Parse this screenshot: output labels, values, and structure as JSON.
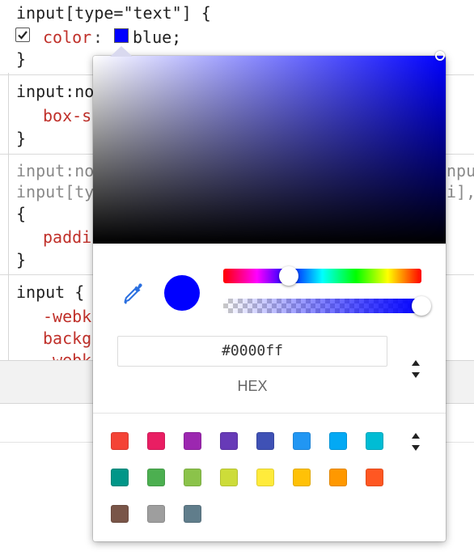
{
  "styles": {
    "rule1": {
      "selector": "input[type=\"text\"] {",
      "property": "color",
      "colon": ":",
      "value": "blue;",
      "close": "}"
    },
    "rule2": {
      "selector": "input:no",
      "property": "box-s",
      "close": "}"
    },
    "rule3": {
      "selector_line1": "input:no",
      "selector_line1_right": "npu",
      "selector_line2": "input[ty",
      "selector_line2_right": "i],",
      "open": "{",
      "property": "paddi",
      "close": "}"
    },
    "rule4": {
      "selector": "input {",
      "property1": "-webk",
      "property2": "backg",
      "property3": "-webk"
    }
  },
  "picker": {
    "color_hex": "#0000ff",
    "format_label": "HEX",
    "hue_position": 0.33,
    "alpha_value": 1.0,
    "palette": [
      {
        "name": "red",
        "color": "#f44336"
      },
      {
        "name": "pink",
        "color": "#e91e63"
      },
      {
        "name": "purple",
        "color": "#9c27b0"
      },
      {
        "name": "deep-purple",
        "color": "#673ab7"
      },
      {
        "name": "indigo",
        "color": "#3f51b5"
      },
      {
        "name": "blue",
        "color": "#2196f3"
      },
      {
        "name": "light-blue",
        "color": "#03a9f4"
      },
      {
        "name": "cyan",
        "color": "#00bcd4"
      },
      {
        "name": "teal",
        "color": "#009688"
      },
      {
        "name": "green",
        "color": "#4caf50"
      },
      {
        "name": "light-green",
        "color": "#8bc34a"
      },
      {
        "name": "lime",
        "color": "#cddc39"
      },
      {
        "name": "yellow",
        "color": "#ffeb3b"
      },
      {
        "name": "amber",
        "color": "#ffc107"
      },
      {
        "name": "orange",
        "color": "#ff9800"
      },
      {
        "name": "deep-orange",
        "color": "#ff5722"
      },
      {
        "name": "brown",
        "color": "#795548"
      },
      {
        "name": "grey",
        "color": "#9e9e9e"
      },
      {
        "name": "blue-grey",
        "color": "#607d8b"
      }
    ]
  },
  "icons": {
    "checkbox": "checkmark-icon",
    "eyedropper": "eyedropper-icon",
    "format_stepper": "stepper-arrows-icon",
    "palette_stepper": "stepper-arrows-icon"
  },
  "colors": {
    "property_red": "#c0302a",
    "current_color": "#0000ff"
  }
}
